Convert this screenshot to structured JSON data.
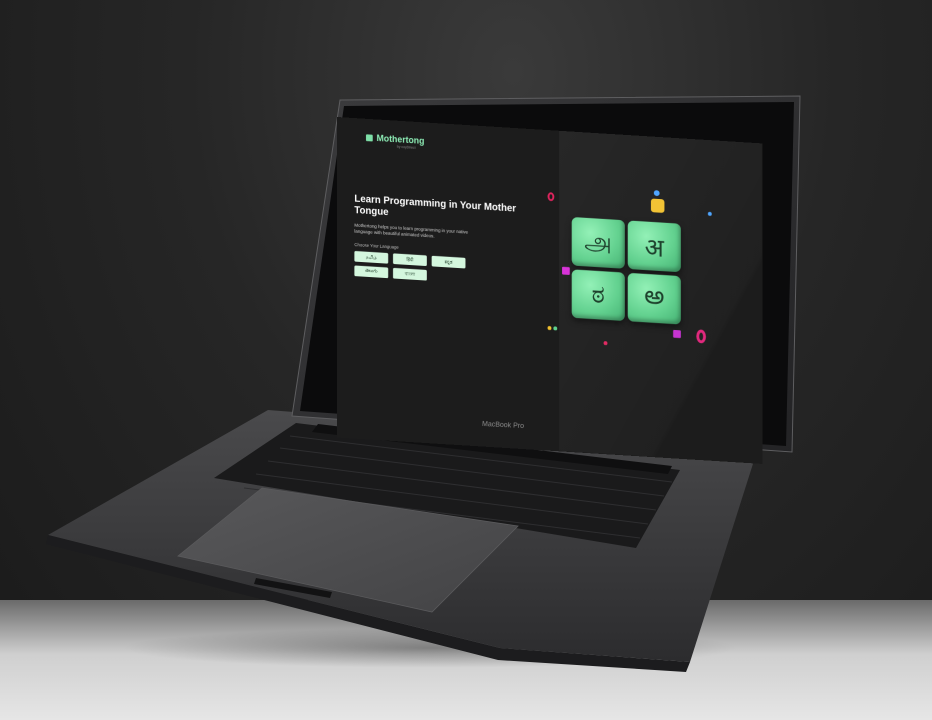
{
  "device": {
    "model_label": "MacBook Pro"
  },
  "app": {
    "brand_name": "Mothertong",
    "brand_sub": "by coyDirect",
    "hero_title": "Learn Programming in Your Mother Tongue",
    "hero_description": "Mothertong helps you to learn programming in your native language with beautiful animated videos.",
    "choose_label": "Choose Your Language",
    "languages": [
      {
        "label": "தமிழ்"
      },
      {
        "label": "हिंदी"
      },
      {
        "label": "ಕನ್ನಡ"
      },
      {
        "label": "తెలుగు"
      },
      {
        "label": "বাংলা"
      }
    ],
    "tiles": [
      "அ",
      "अ",
      "ಠ",
      "అ"
    ],
    "colors": {
      "accent": "#7ee0a8",
      "tile": "#5fd18d",
      "background": "#1c1c1c",
      "button": "#d4f7de"
    }
  }
}
